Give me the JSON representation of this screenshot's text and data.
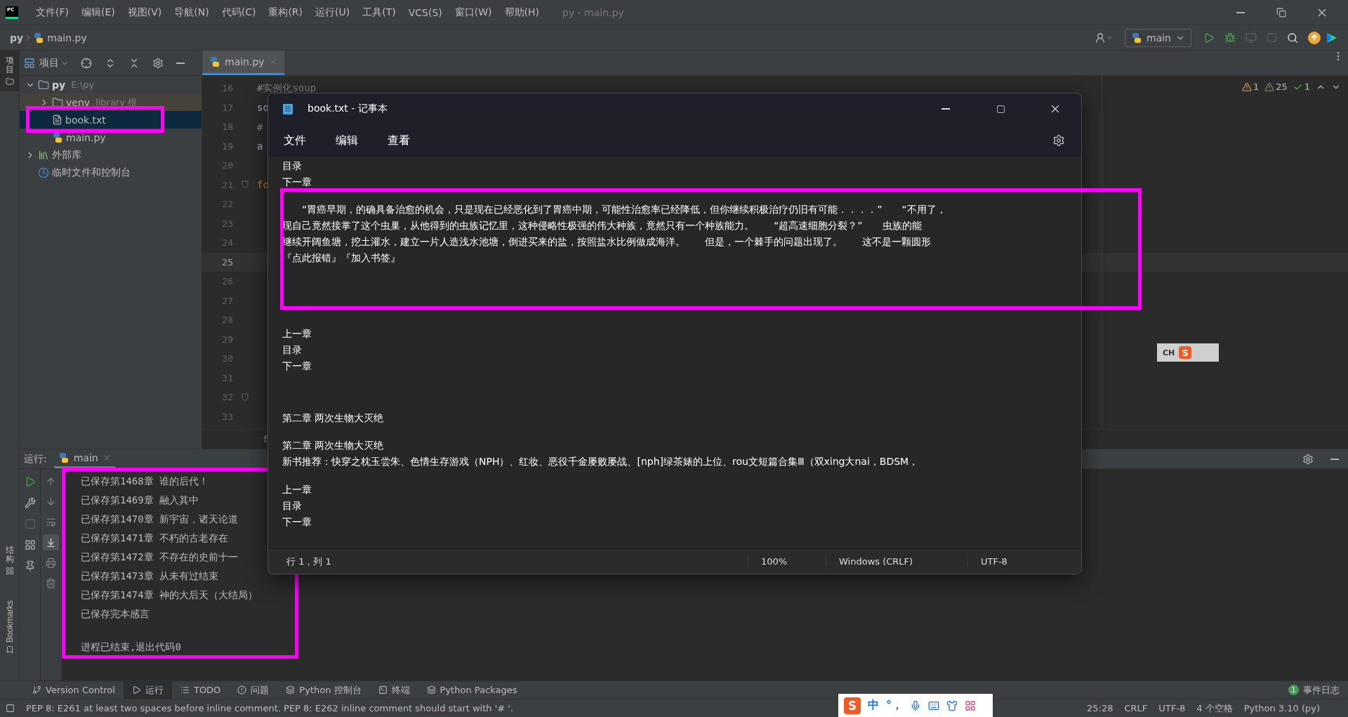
{
  "ide": {
    "logo": "PC",
    "title": "py - main.py",
    "menu": [
      "文件(F)",
      "编辑(E)",
      "视图(V)",
      "导航(N)",
      "代码(C)",
      "重构(R)",
      "运行(U)",
      "工具(T)",
      "VCS(S)",
      "窗口(W)",
      "帮助(H)"
    ]
  },
  "nav": {
    "breadcrumb": [
      "py",
      "main.py"
    ],
    "run_config": "main"
  },
  "side_strip": {
    "top": [
      {
        "label": "项目",
        "selected": true
      }
    ],
    "bottom": [
      {
        "label": "结构",
        "kind": "cjk"
      },
      {
        "label": "Bookmarks",
        "kind": "latin"
      }
    ]
  },
  "project": {
    "label": "项目",
    "tree": [
      {
        "label": "py",
        "hint": "E:\\py",
        "kind": "folder",
        "expanded": true,
        "selected": false,
        "children": [
          {
            "label": "venv",
            "hint": "library 根",
            "kind": "folder",
            "expanded": false,
            "selected": false
          },
          {
            "label": "book.txt",
            "kind": "text",
            "selected": true,
            "highlighted": true
          },
          {
            "label": "main.py",
            "kind": "python",
            "selected": false
          }
        ]
      },
      {
        "label": "外部库",
        "kind": "library",
        "expanded": false,
        "selected": false
      },
      {
        "label": "临时文件和控制台",
        "kind": "scratch",
        "selected": false
      }
    ]
  },
  "editor": {
    "tabs": [
      {
        "label": "main.py",
        "selected": true
      }
    ],
    "inspections": [
      {
        "kind": "error",
        "count": "1"
      },
      {
        "kind": "warning",
        "count": "25"
      },
      {
        "kind": "typo",
        "count": "1"
      }
    ],
    "lines": [
      {
        "number": "16",
        "code": "#实例化soup",
        "kind": "comment",
        "current": false,
        "fold": false
      },
      {
        "number": "17",
        "code": "so",
        "kind": "plain",
        "current": false,
        "fold": false
      },
      {
        "number": "18",
        "code": "#",
        "kind": "comment",
        "current": false,
        "fold": false
      },
      {
        "number": "19",
        "code": "a",
        "kind": "plain",
        "current": false,
        "fold": false
      },
      {
        "number": "20",
        "current": false,
        "fold": false
      },
      {
        "number": "21",
        "code": "fo",
        "kind": "keyword",
        "current": false,
        "fold": true
      },
      {
        "number": "22",
        "current": false,
        "fold": false
      },
      {
        "number": "23",
        "current": false,
        "fold": false
      },
      {
        "number": "24",
        "current": false,
        "fold": false
      },
      {
        "number": "25",
        "current": true,
        "fold": false
      },
      {
        "number": "26",
        "current": false,
        "fold": false
      },
      {
        "number": "27",
        "current": false,
        "fold": false
      },
      {
        "number": "28",
        "current": false,
        "fold": false
      },
      {
        "number": "29",
        "current": false,
        "fold": false
      },
      {
        "number": "30",
        "current": false,
        "fold": false
      },
      {
        "number": "31",
        "current": false,
        "fold": false
      },
      {
        "number": "32",
        "current": false,
        "fold": true
      },
      {
        "number": "33",
        "current": false,
        "fold": false
      }
    ],
    "breadcrumb": "f"
  },
  "run": {
    "label": "运行:",
    "tabs": [
      {
        "label": "main",
        "selected": true
      }
    ],
    "toggles": [
      {
        "kind": "up",
        "on": false
      },
      {
        "kind": "down",
        "on": false
      },
      {
        "kind": "wrap",
        "on": false
      },
      {
        "kind": "scroll-end",
        "on": true
      },
      {
        "kind": "print",
        "on": false
      },
      {
        "kind": "clear",
        "on": false
      }
    ],
    "highlighted": true,
    "output": [
      {
        "kind": "line",
        "text": "已保存第1468章 谁的后代！"
      },
      {
        "kind": "line",
        "text": "已保存第1469章 融入其中"
      },
      {
        "kind": "line",
        "text": "已保存第1470章 新宇宙，诸天论道"
      },
      {
        "kind": "line",
        "text": "已保存第1471章 不朽的古老存在"
      },
      {
        "kind": "line",
        "text": "已保存第1472章 不存在的史前十一"
      },
      {
        "kind": "line",
        "text": "已保存第1473章 从未有过结束"
      },
      {
        "kind": "line",
        "text": "已保存第1474章 神的大后天（大结局）"
      },
      {
        "kind": "line",
        "text": "已保存完本感言"
      },
      {
        "kind": "exit",
        "text": "进程已结束,退出代码0"
      }
    ]
  },
  "notepad": {
    "title": "book.txt - 记事本",
    "menu": [
      "文件",
      "编辑",
      "查看"
    ],
    "blocks": [
      {
        "lines": [
          "目录",
          "下一章"
        ]
      },
      {
        "highlighted": true,
        "lines": [
          "　　“胃癌早期，的确具备治愈的机会，只是现在已经恶化到了胃癌中期，可能性治愈率已经降低，但你继续积极治疗仍旧有可能．．．．”　　“不用了，",
          "现自己竟然接掌了这个虫巢，从他得到的虫族记忆里，这种侵略性极强的伟大种族，竟然只有一个种族能力。　　“超高速细胞分裂？”　　虫族的能",
          "继续开阔鱼塘，挖土灌水，建立一片人造浅水池塘，倒进买来的盐，按照盐水比例做成海洋。　　但是，一个棘手的问题出现了。　　这不是一颗圆形",
          "『点此报错』『加入书签』"
        ]
      },
      {
        "lines": [
          "上一章",
          "目录",
          "下一章"
        ]
      },
      {
        "lines": [
          "第二章 两次生物大灭绝"
        ]
      },
      {
        "lines": [
          "第二章 两次生物大灭绝",
          "新书推荐：快穿之枕玉尝朱、色情生存游戏（NPH）、红妆、恶役千金屡败屡战、[nph]绿茶婊的上位、rou文短篇合集Ⅲ（双xing大nai，BDSM，"
        ]
      },
      {
        "lines": [
          "上一章",
          "目录",
          "下一章"
        ]
      }
    ],
    "status": [
      "行 1，列 1",
      "100%",
      "Windows (CRLF)",
      "UTF-8"
    ]
  },
  "tool_tabs": [
    {
      "kind": "vcs",
      "label": "Version Control",
      "selected": false
    },
    {
      "kind": "run",
      "label": "运行",
      "selected": true
    },
    {
      "kind": "todo",
      "label": "TODO",
      "selected": false
    },
    {
      "kind": "problems",
      "label": "问题",
      "selected": false
    },
    {
      "kind": "console",
      "label": "Python 控制台",
      "selected": false
    },
    {
      "kind": "terminal",
      "label": "终端",
      "selected": false
    },
    {
      "kind": "packages",
      "label": "Python Packages",
      "selected": false
    }
  ],
  "event_log": {
    "label": "事件日志",
    "badge": "1"
  },
  "status_bar": {
    "message": "PEP 8: E261 at least two spaces before inline comment. PEP 8: E262 inline comment should start with '# '.",
    "items": [
      "25:28",
      "CRLF",
      "UTF-8",
      "4 个空格",
      "Python 3.10 (py)"
    ]
  },
  "ime_bar": {
    "logo": "S",
    "mode": "中",
    "punct": "°，"
  },
  "ime_float": {
    "label": "CH",
    "logo": "S"
  }
}
